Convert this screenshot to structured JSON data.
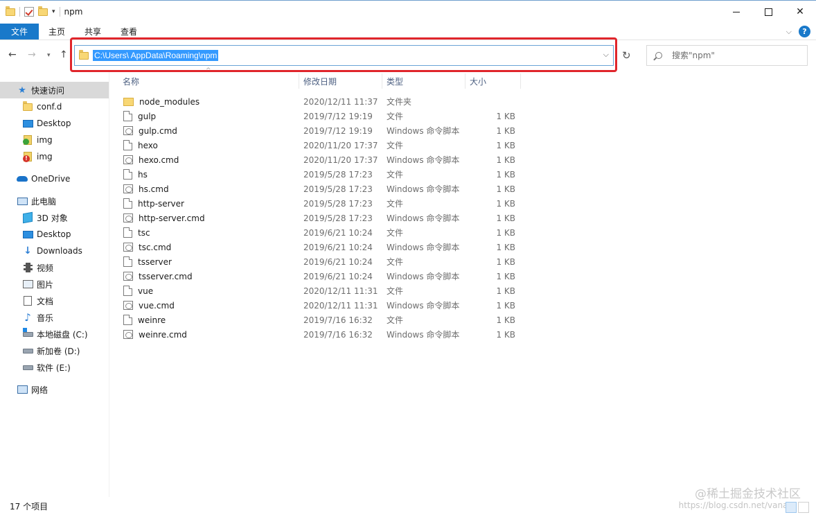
{
  "window": {
    "title": "npm",
    "qat_dropdown": "▾",
    "controls": {
      "minimize": "",
      "maximize": "",
      "close": "✕"
    }
  },
  "ribbon": {
    "tabs": [
      {
        "label": "文件",
        "active": true
      },
      {
        "label": "主页"
      },
      {
        "label": "共享"
      },
      {
        "label": "查看"
      }
    ],
    "expand": "⌵",
    "help": "?"
  },
  "nav": {
    "back": "←",
    "forward": "→",
    "recent": "▾",
    "up": "↑",
    "refresh": "↻",
    "address": "C:\\Users\\            AppData\\Roaming\\npm",
    "address_dropdown": "⌵",
    "search_placeholder": "搜索\"npm\""
  },
  "sidebar": {
    "items": [
      {
        "label": "快速访问",
        "icon": "star-icon",
        "selected": true
      },
      {
        "label": "conf.d",
        "icon": "folder-icon"
      },
      {
        "label": "Desktop",
        "icon": "desktop-icon"
      },
      {
        "label": "img",
        "icon": "image-folder-ok-icon"
      },
      {
        "label": "img",
        "icon": "image-folder-error-icon"
      },
      {
        "label": "OneDrive",
        "icon": "cloud-icon"
      },
      {
        "label": "此电脑",
        "icon": "computer-icon"
      },
      {
        "label": "3D 对象",
        "icon": "cube-icon"
      },
      {
        "label": "Desktop",
        "icon": "desktop-icon"
      },
      {
        "label": "Downloads",
        "icon": "download-icon"
      },
      {
        "label": "视频",
        "icon": "video-icon"
      },
      {
        "label": "图片",
        "icon": "picture-icon"
      },
      {
        "label": "文档",
        "icon": "document-icon"
      },
      {
        "label": "音乐",
        "icon": "music-icon"
      },
      {
        "label": "本地磁盘 (C:)",
        "icon": "drive-c-icon"
      },
      {
        "label": "新加卷 (D:)",
        "icon": "drive-icon"
      },
      {
        "label": "软件 (E:)",
        "icon": "drive-icon"
      },
      {
        "label": "网络",
        "icon": "network-icon"
      }
    ]
  },
  "columns": {
    "name": "名称",
    "date": "修改日期",
    "type": "类型",
    "size": "大小",
    "sort_indicator": "^"
  },
  "files": [
    {
      "name": "node_modules",
      "date": "2020/12/11 11:37",
      "type": "文件夹",
      "size": "",
      "icon": "folder-icon"
    },
    {
      "name": "gulp",
      "date": "2019/7/12 19:19",
      "type": "文件",
      "size": "1 KB",
      "icon": "file-icon"
    },
    {
      "name": "gulp.cmd",
      "date": "2019/7/12 19:19",
      "type": "Windows 命令脚本",
      "size": "1 KB",
      "icon": "cmd-script-icon"
    },
    {
      "name": "hexo",
      "date": "2020/11/20 17:37",
      "type": "文件",
      "size": "1 KB",
      "icon": "file-icon"
    },
    {
      "name": "hexo.cmd",
      "date": "2020/11/20 17:37",
      "type": "Windows 命令脚本",
      "size": "1 KB",
      "icon": "cmd-script-icon"
    },
    {
      "name": "hs",
      "date": "2019/5/28 17:23",
      "type": "文件",
      "size": "1 KB",
      "icon": "file-icon"
    },
    {
      "name": "hs.cmd",
      "date": "2019/5/28 17:23",
      "type": "Windows 命令脚本",
      "size": "1 KB",
      "icon": "cmd-script-icon"
    },
    {
      "name": "http-server",
      "date": "2019/5/28 17:23",
      "type": "文件",
      "size": "1 KB",
      "icon": "file-icon"
    },
    {
      "name": "http-server.cmd",
      "date": "2019/5/28 17:23",
      "type": "Windows 命令脚本",
      "size": "1 KB",
      "icon": "cmd-script-icon"
    },
    {
      "name": "tsc",
      "date": "2019/6/21 10:24",
      "type": "文件",
      "size": "1 KB",
      "icon": "file-icon"
    },
    {
      "name": "tsc.cmd",
      "date": "2019/6/21 10:24",
      "type": "Windows 命令脚本",
      "size": "1 KB",
      "icon": "cmd-script-icon"
    },
    {
      "name": "tsserver",
      "date": "2019/6/21 10:24",
      "type": "文件",
      "size": "1 KB",
      "icon": "file-icon"
    },
    {
      "name": "tsserver.cmd",
      "date": "2019/6/21 10:24",
      "type": "Windows 命令脚本",
      "size": "1 KB",
      "icon": "cmd-script-icon"
    },
    {
      "name": "vue",
      "date": "2020/12/11 11:31",
      "type": "文件",
      "size": "1 KB",
      "icon": "file-icon"
    },
    {
      "name": "vue.cmd",
      "date": "2020/12/11 11:31",
      "type": "Windows 命令脚本",
      "size": "1 KB",
      "icon": "cmd-script-icon"
    },
    {
      "name": "weinre",
      "date": "2019/7/16 16:32",
      "type": "文件",
      "size": "1 KB",
      "icon": "file-icon"
    },
    {
      "name": "weinre.cmd",
      "date": "2019/7/16 16:32",
      "type": "Windows 命令脚本",
      "size": "1 KB",
      "icon": "cmd-script-icon"
    }
  ],
  "status": {
    "item_count": "17 个项目"
  },
  "watermark": {
    "brand": "@稀土掘金技术社区",
    "url": "https://blog.csdn.net/vanasz"
  },
  "colors": {
    "accent": "#1979ca",
    "selection": "#3399ff",
    "highlight_box": "#e0252b"
  }
}
